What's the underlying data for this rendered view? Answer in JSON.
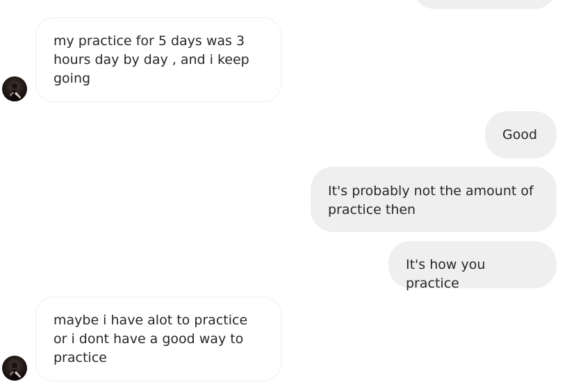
{
  "conversation": {
    "messages": [
      {
        "sender": "them",
        "text": "my practice for 5 days was 3 hours day by day , and i keep going"
      },
      {
        "sender": "me",
        "text": "Good"
      },
      {
        "sender": "me",
        "text": "It's probably not the amount of practice then"
      },
      {
        "sender": "me",
        "text": "It's how you practice"
      },
      {
        "sender": "them",
        "text": "maybe i have alot to practice or i dont have a good way to practice"
      }
    ]
  },
  "colors": {
    "outgoing_bubble": "#efefef",
    "incoming_border": "#efefef",
    "text": "#262626"
  }
}
